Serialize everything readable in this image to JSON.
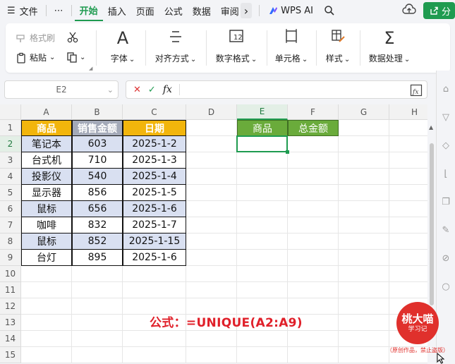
{
  "menubar": {
    "hamburger": "☰",
    "items": [
      "文件",
      "⋯",
      "开始",
      "插入",
      "页面",
      "公式",
      "数据",
      "审阅"
    ],
    "active_index": 2,
    "more": "›",
    "wps_ai": "WPS AI",
    "share": "分"
  },
  "ribbon": {
    "format_painter": "格式刷",
    "paste": "粘贴",
    "groups": [
      "字体",
      "对齐方式",
      "数字格式",
      "单元格",
      "样式",
      "数据处理"
    ],
    "dropdown_glyph": "⌄"
  },
  "formula_bar": {
    "name_box": "E2",
    "cancel": "✕",
    "confirm": "✓",
    "fx": "fx",
    "content": ""
  },
  "sheet": {
    "columns": [
      "A",
      "B",
      "C",
      "D",
      "E",
      "F",
      "G",
      "H"
    ],
    "selected_column": "E",
    "rows": [
      "1",
      "2",
      "3",
      "4",
      "5",
      "6",
      "7",
      "8",
      "9",
      "10",
      "11",
      "12",
      "13",
      "14",
      "15"
    ],
    "selected_row": "2",
    "table_headers": [
      "商品",
      "销售金额",
      "日期"
    ],
    "table_rows": [
      [
        "笔记本",
        "603",
        "2025-1-2"
      ],
      [
        "台式机",
        "710",
        "2025-1-3"
      ],
      [
        "投影仪",
        "540",
        "2025-1-4"
      ],
      [
        "显示器",
        "856",
        "2025-1-5"
      ],
      [
        "鼠标",
        "656",
        "2025-1-6"
      ],
      [
        "咖啡",
        "832",
        "2025-1-7"
      ],
      [
        "鼠标",
        "852",
        "2025-1-15"
      ],
      [
        "台灯",
        "895",
        "2025-1-6"
      ]
    ],
    "result_headers": [
      "商品",
      "总金额"
    ],
    "selected_cell": "E2"
  },
  "annotation": {
    "formula_text": "公式：=UNIQUE(A2:A9)"
  },
  "watermark": {
    "line1": "桃大喵",
    "line2": "学习记",
    "note": "（原创作品，禁止盗版）"
  },
  "colors": {
    "accent_green": "#1f9b50",
    "header_yellow": "#f2b50c",
    "header_gray": "#a3a9b8",
    "band_blue": "#d9e0f1",
    "result_header_green": "#6aab3b",
    "annotation_red": "#e0202a"
  }
}
